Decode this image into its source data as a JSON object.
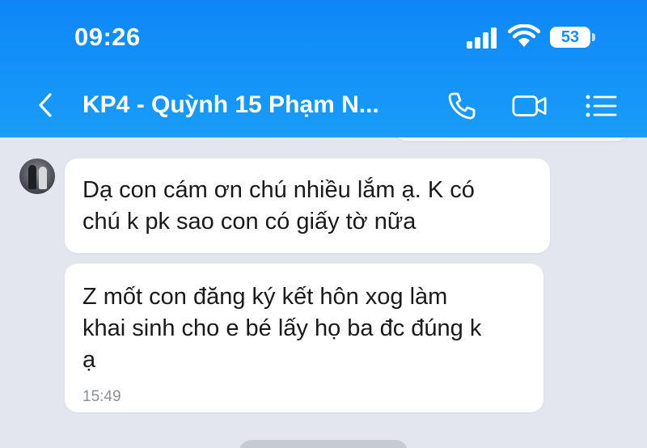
{
  "status_bar": {
    "time": "09:26",
    "battery": "53",
    "icons": [
      "signal-icon",
      "wifi-icon",
      "battery-icon"
    ]
  },
  "header": {
    "title": "KP4 - Quỳnh 15 Phạm N...",
    "icons": [
      "back-chevron-icon",
      "phone-icon",
      "video-camera-icon",
      "menu-list-icon"
    ]
  },
  "messages": [
    {
      "lines": [
        "Dạ con cám ơn chú nhiều lắm ạ. K có",
        "chú k pk sao con có giấy tờ nữa"
      ]
    },
    {
      "lines": [
        "Z mốt con đăng ký kết hôn xog làm",
        "khai sinh cho e bé lấy họ ba đc đúng k",
        "ạ"
      ],
      "time": "15:49"
    }
  ],
  "colors": {
    "header_blue": "#1493f8",
    "chat_background": "#e3e6ec",
    "bubble": "#ffffff",
    "timestamp": "#8c8f96"
  }
}
